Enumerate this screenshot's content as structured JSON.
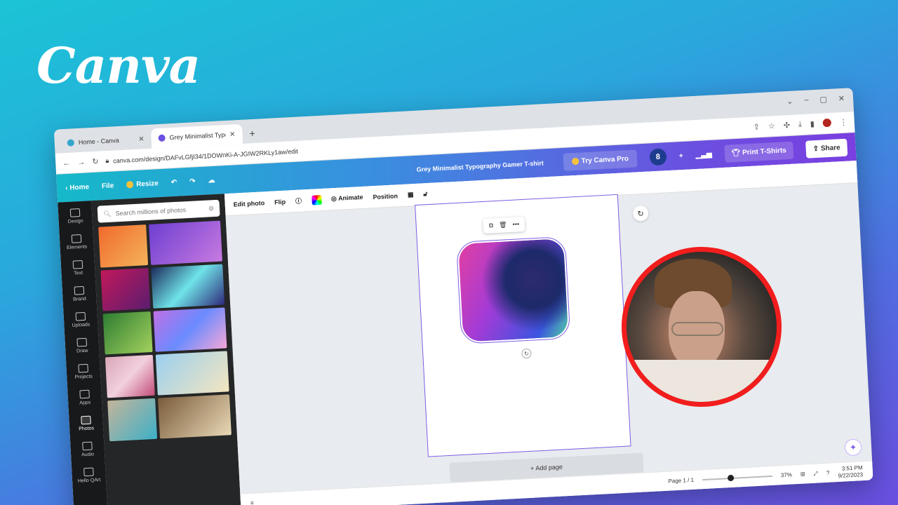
{
  "brand": {
    "logo_text": "Canva"
  },
  "browser": {
    "tabs": [
      {
        "label": "Home - Canva",
        "active": false
      },
      {
        "label": "Grey Minimalist Typography Gamer T-shirt",
        "active": true
      }
    ],
    "new_tab": "+",
    "url": "canva.com/design/DAFvLGfjI34/1DOWnKi-A-JGIW2RKLy1aw/edit"
  },
  "canva_bar": {
    "home": "Home",
    "file": "File",
    "resize": "Resize",
    "title": "Grey Minimalist Typography Gamer T-shirt",
    "try_pro": "Try Canva Pro",
    "collab_count": "8",
    "print": "Print T-Shirts",
    "share": "Share"
  },
  "rail": [
    {
      "label": "Design",
      "icon": "layout-icon"
    },
    {
      "label": "Elements",
      "icon": "shapes-icon"
    },
    {
      "label": "Text",
      "icon": "text-icon"
    },
    {
      "label": "Brand",
      "icon": "brand-icon"
    },
    {
      "label": "Uploads",
      "icon": "cloud-upload-icon"
    },
    {
      "label": "Draw",
      "icon": "pen-icon"
    },
    {
      "label": "Projects",
      "icon": "folder-icon"
    },
    {
      "label": "Apps",
      "icon": "grid-icon"
    },
    {
      "label": "Photos",
      "icon": "photo-icon",
      "active": true
    },
    {
      "label": "Audio",
      "icon": "music-icon"
    },
    {
      "label": "Hello QArt",
      "icon": "qr-icon"
    }
  ],
  "panel": {
    "search_placeholder": "Search millions of photos"
  },
  "context_toolbar": {
    "edit_photo": "Edit photo",
    "flip": "Flip",
    "animate": "Animate",
    "position": "Position"
  },
  "canvas": {
    "add_page": "+ Add page"
  },
  "footer": {
    "page": "Page 1 / 1",
    "zoom": "37%",
    "time": "3:51 PM",
    "date": "9/22/2023"
  }
}
